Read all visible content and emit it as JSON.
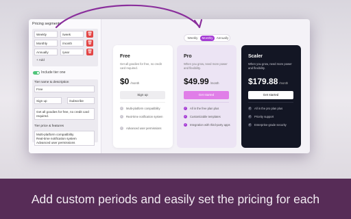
{
  "editor": {
    "title": "Pricing segments",
    "segments": [
      {
        "name": "Weekly",
        "suffix": "/week"
      },
      {
        "name": "Monthly",
        "suffix": "/month"
      },
      {
        "name": "Annually",
        "suffix": "/year"
      }
    ],
    "add_label": "+ Add",
    "include_tier_label": "Include tier one",
    "tier_section_label": "Tier name & description",
    "tier_name": "Free",
    "button_text": "Sign up",
    "button_link": "/subscribe",
    "tier_description": "Get all goodies for free, no credit card required.",
    "price_section_label": "Tier price & features",
    "features": [
      "Multi-platform compatibility",
      "Real-time notification system",
      "Advanced user permissions"
    ]
  },
  "periods": [
    "Weekly",
    "Monthly",
    "Annually"
  ],
  "active_period": "Monthly",
  "plans": [
    {
      "name": "Free",
      "description": "Get all goodies for free, no credit card required.",
      "price": "$0",
      "period": "/month",
      "button": "Sign up",
      "features": [
        "Multi-platform compatibility",
        "Real-time notification system",
        "Advanced user permissions"
      ]
    },
    {
      "name": "Pro",
      "description": "When you grow, need more power and flexibility.",
      "price": "$49.99",
      "period": "/month",
      "button": "Get started",
      "features": [
        "All in the free plan plus",
        "Customizable templates",
        "Integration with third-party apps"
      ]
    },
    {
      "name": "Scaler",
      "description": "When you grow, need more power and flexibility.",
      "price": "$179.88",
      "period": "/month",
      "button": "Get started",
      "features": [
        "All in the pro plan plus",
        "Priority support",
        "Enterprise-grade security"
      ]
    }
  ],
  "banner": "Add custom periods and easily set the pricing for each",
  "colors": {
    "accent": "#a43ad4",
    "accent_light": "#e07ee8",
    "banner": "#572c57",
    "delete": "#e34545",
    "toggle_on": "#4fc47a"
  }
}
